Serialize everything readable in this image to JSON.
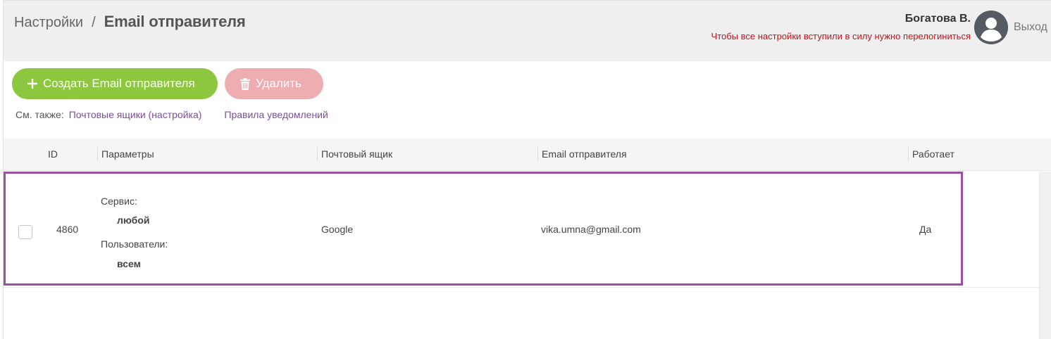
{
  "header": {
    "breadcrumb_parent": "Настройки",
    "breadcrumb_separator": "/",
    "title": "Email отправителя",
    "user_name": "Богатова В.",
    "relogin_note": "Чтобы все настройки вступили в силу нужно перелогиниться",
    "logout_label": "Выход",
    "avatar_icon": "user-avatar-icon"
  },
  "actions": {
    "create_label": "Создать Email отправителя",
    "create_icon": "plus-icon",
    "delete_label": "Удалить",
    "delete_icon": "trash-icon"
  },
  "see_also": {
    "label": "См. также:",
    "link1": "Почтовые ящики (настройка)",
    "link2": "Правила уведомлений"
  },
  "table": {
    "columns": [
      "ID",
      "Параметры",
      "Почтовый ящик",
      "Email отправителя",
      "Работает"
    ],
    "rows": [
      {
        "id": "4860",
        "service_label": "Сервис:",
        "service_value": "любой",
        "users_label": "Пользователи:",
        "users_value": "всем",
        "mailbox": "Google",
        "sender_email": "vika.umna@gmail.com",
        "active": "Да"
      }
    ]
  },
  "colors": {
    "create_button": "#8dc63f",
    "delete_button": "#eeadb0",
    "link": "#7c4d9b",
    "warning_text": "#c0161b",
    "row_highlight": "#9c4fa5"
  }
}
